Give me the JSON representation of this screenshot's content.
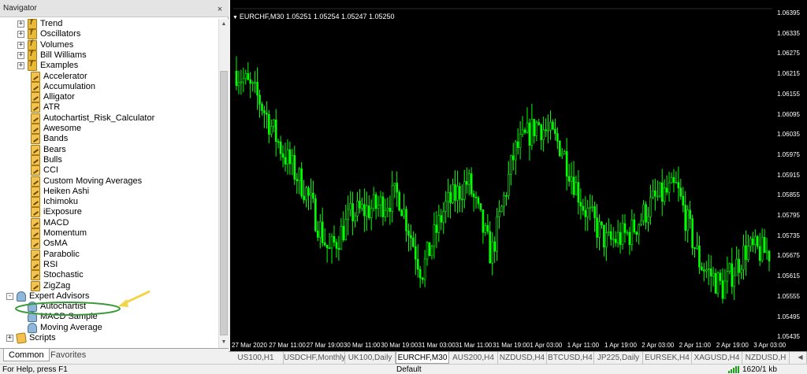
{
  "navigator": {
    "title": "Navigator",
    "close_icon": "close-icon",
    "tabs": [
      "Common",
      "Favorites"
    ],
    "tree": [
      {
        "label": "Trend",
        "icon": "function-folder-icon",
        "indent": 1,
        "expander": "+"
      },
      {
        "label": "Oscillators",
        "icon": "function-folder-icon",
        "indent": 1,
        "expander": "+"
      },
      {
        "label": "Volumes",
        "icon": "function-folder-icon",
        "indent": 1,
        "expander": "+"
      },
      {
        "label": "Bill Williams",
        "icon": "function-folder-icon",
        "indent": 1,
        "expander": "+"
      },
      {
        "label": "Examples",
        "icon": "function-folder-icon",
        "indent": 1,
        "expander": "+"
      },
      {
        "label": "Accelerator",
        "icon": "indicator-icon",
        "indent": 2
      },
      {
        "label": "Accumulation",
        "icon": "indicator-icon",
        "indent": 2
      },
      {
        "label": "Alligator",
        "icon": "indicator-icon",
        "indent": 2
      },
      {
        "label": "ATR",
        "icon": "indicator-icon",
        "indent": 2
      },
      {
        "label": "Autochartist_Risk_Calculator",
        "icon": "indicator-icon",
        "indent": 2
      },
      {
        "label": "Awesome",
        "icon": "indicator-icon",
        "indent": 2
      },
      {
        "label": "Bands",
        "icon": "indicator-icon",
        "indent": 2
      },
      {
        "label": "Bears",
        "icon": "indicator-icon",
        "indent": 2
      },
      {
        "label": "Bulls",
        "icon": "indicator-icon",
        "indent": 2
      },
      {
        "label": "CCI",
        "icon": "indicator-icon",
        "indent": 2
      },
      {
        "label": "Custom Moving Averages",
        "icon": "indicator-icon",
        "indent": 2
      },
      {
        "label": "Heiken Ashi",
        "icon": "indicator-icon",
        "indent": 2
      },
      {
        "label": "Ichimoku",
        "icon": "indicator-icon",
        "indent": 2
      },
      {
        "label": "iExposure",
        "icon": "indicator-icon",
        "indent": 2
      },
      {
        "label": "MACD",
        "icon": "indicator-icon",
        "indent": 2
      },
      {
        "label": "Momentum",
        "icon": "indicator-icon",
        "indent": 2
      },
      {
        "label": "OsMA",
        "icon": "indicator-icon",
        "indent": 2
      },
      {
        "label": "Parabolic",
        "icon": "indicator-icon",
        "indent": 2
      },
      {
        "label": "RSI",
        "icon": "indicator-icon",
        "indent": 2
      },
      {
        "label": "Stochastic",
        "icon": "indicator-icon",
        "indent": 2
      },
      {
        "label": "ZigZag",
        "icon": "indicator-icon",
        "indent": 2
      },
      {
        "label": "Expert Advisors",
        "icon": "expert-advisors-icon",
        "indent": 0,
        "expander": "-"
      },
      {
        "label": "Autochartist",
        "icon": "expert-icon",
        "indent": 1
      },
      {
        "label": "MACD Sample",
        "icon": "expert-icon",
        "indent": 1
      },
      {
        "label": "Moving Average",
        "icon": "expert-icon",
        "indent": 1
      },
      {
        "label": "Scripts",
        "icon": "scripts-icon",
        "indent": 0,
        "expander": "+"
      }
    ]
  },
  "chart": {
    "title": "EURCHF,M30  1.05251 1.05254 1.05247 1.05250",
    "menu_icon": "chart-menu-triangle-icon",
    "price_ticks": [
      "1.06395",
      "1.06335",
      "1.06275",
      "1.06215",
      "1.06155",
      "1.06095",
      "1.06035",
      "1.05975",
      "1.05915",
      "1.05855",
      "1.05795",
      "1.05735",
      "1.05675",
      "1.05615",
      "1.05555",
      "1.05495",
      "1.05435"
    ],
    "time_ticks": [
      "27 Mar 2020",
      "27 Mar 11:00",
      "27 Mar 19:00",
      "30 Mar 11:00",
      "30 Mar 19:00",
      "31 Mar 03:00",
      "31 Mar 11:00",
      "31 Mar 19:00",
      "1 Apr 03:00",
      "1 Apr 11:00",
      "1 Apr 19:00",
      "2 Apr 03:00",
      "2 Apr 11:00",
      "2 Apr 19:00",
      "3 Apr 03:00"
    ],
    "candle_color": "#00ff00",
    "background": "#000000"
  },
  "chart_data": {
    "type": "line",
    "title": "EURCHF,M30  1.05251 1.05254 1.05247 1.05250",
    "xlabel": "",
    "ylabel": "",
    "ylim": [
      1.05405,
      1.06425
    ],
    "x": [
      "27 Mar 2020",
      "27 Mar 11:00",
      "27 Mar 19:00",
      "30 Mar 11:00",
      "30 Mar 19:00",
      "31 Mar 03:00",
      "31 Mar 11:00",
      "31 Mar 19:00",
      "1 Apr 03:00",
      "1 Apr 11:00",
      "1 Apr 19:00",
      "2 Apr 03:00",
      "2 Apr 11:00",
      "2 Apr 19:00",
      "3 Apr 03:00"
    ],
    "series": [
      {
        "values": [
          1.0623,
          1.0614,
          1.0598,
          1.0586,
          1.0567,
          1.0579,
          1.0581,
          1.0585,
          1.0561,
          1.0581,
          1.0589,
          1.0566,
          1.0598,
          1.0607,
          1.06,
          1.0581,
          1.057,
          1.0573,
          1.0583,
          1.0587,
          1.0564,
          1.0556,
          1.0568,
          1.0567
        ]
      }
    ],
    "grid": false,
    "legend": "none"
  },
  "chart_tabs": [
    {
      "label": "US100,H1",
      "active": false
    },
    {
      "label": "USDCHF,Monthly",
      "active": false
    },
    {
      "label": "UK100,Daily",
      "active": false
    },
    {
      "label": "EURCHF,M30",
      "active": true
    },
    {
      "label": "AUS200,H4",
      "active": false
    },
    {
      "label": "NZDUSD,H4",
      "active": false
    },
    {
      "label": "BTCUSD,H4",
      "active": false
    },
    {
      "label": "JP225,Daily",
      "active": false
    },
    {
      "label": "EURSEK,H4",
      "active": false
    },
    {
      "label": "XAGUSD,H4",
      "active": false
    },
    {
      "label": "NZDUSD,H",
      "active": false
    }
  ],
  "tab_scroll_icon": "tab-scroll-left-icon",
  "status": {
    "help": "For Help, press F1",
    "profile": "Default",
    "traffic": "1620/1 kb",
    "connection_icon": "connection-bars-icon"
  },
  "annotation": {
    "arrow_color": "#f2d54a",
    "circle_color": "#3a9a3a"
  }
}
